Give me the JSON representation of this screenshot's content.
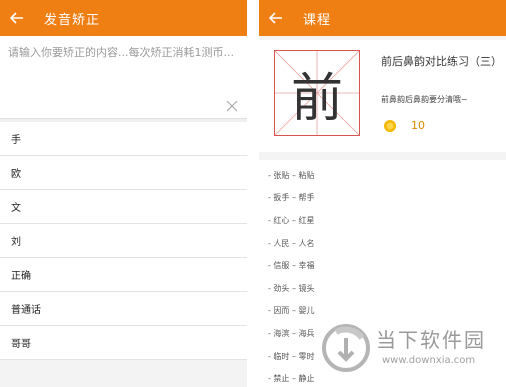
{
  "left": {
    "title": "发音矫正",
    "input_placeholder": "请输入你要矫正的内容...每次矫正消耗1测币...",
    "words": [
      "手",
      "欧",
      "文",
      "刘",
      "正确",
      "普通话",
      "哥哥"
    ]
  },
  "right": {
    "title": "课程",
    "course": {
      "character": "前",
      "title": "前后鼻韵对比练习（三）",
      "description": "前鼻韵后鼻韵要分清哦~",
      "coins": "10"
    },
    "pairs": [
      "- 张贴 – 粘贴",
      "- 扳手 – 帮手",
      "- 红心 – 红星",
      "- 人民 – 人名",
      "- 信服 – 幸福",
      "- 劲头 – 镜头",
      "- 因而 – 婴儿",
      "- 海滨 – 海兵",
      "- 临时 – 零时",
      "- 禁止 – 静止"
    ]
  },
  "watermark": {
    "brand": "当下软件园",
    "url": "www.downxia.com"
  },
  "colors": {
    "accent": "#f07f13",
    "grid": "#d9544f",
    "coin": "#f5b800"
  }
}
